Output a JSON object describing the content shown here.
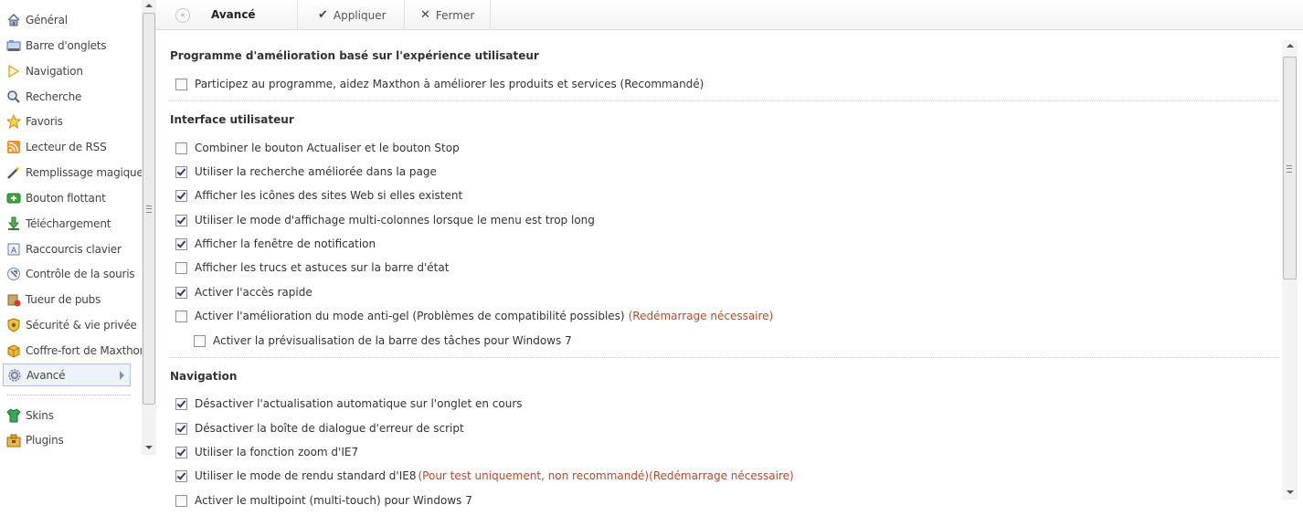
{
  "sidebar": {
    "items": [
      {
        "label": "Général",
        "icon": "home-icon"
      },
      {
        "label": "Barre d'onglets",
        "icon": "tabbar-icon"
      },
      {
        "label": "Navigation",
        "icon": "navigation-arrow-icon"
      },
      {
        "label": "Recherche",
        "icon": "magnifier-icon"
      },
      {
        "label": "Favoris",
        "icon": "star-icon"
      },
      {
        "label": "Lecteur de RSS",
        "icon": "rss-icon"
      },
      {
        "label": "Remplissage magique",
        "icon": "magic-pen-icon"
      },
      {
        "label": "Bouton flottant",
        "icon": "floating-button-icon"
      },
      {
        "label": "Téléchargement",
        "icon": "download-icon"
      },
      {
        "label": "Raccourcis clavier",
        "icon": "keyboard-icon"
      },
      {
        "label": "Contrôle de la souris",
        "icon": "mouse-gesture-icon"
      },
      {
        "label": "Tueur de pubs",
        "icon": "ad-killer-icon"
      },
      {
        "label": "Sécurité & vie privée",
        "icon": "shield-icon"
      },
      {
        "label": "Coffre-fort de Maxthon",
        "icon": "safe-box-icon"
      },
      {
        "label": "Avancé",
        "icon": "gear-icon",
        "active": true
      }
    ],
    "extras": [
      {
        "label": "Skins",
        "icon": "shirt-icon"
      },
      {
        "label": "Plugins",
        "icon": "plugin-box-icon"
      }
    ]
  },
  "toolbar": {
    "back_glyph": "«",
    "title": "Avancé",
    "apply_label": "Appliquer",
    "close_label": "Fermer"
  },
  "sections": [
    {
      "title": "Programme d'amélioration basé sur l'expérience utilisateur",
      "options": [
        {
          "label": "Participez au programme, aidez Maxthon à améliorer les produits et services (Recommandé)",
          "checked": false
        }
      ]
    },
    {
      "title": "Interface utilisateur",
      "options": [
        {
          "label": "Combiner le bouton Actualiser et le bouton Stop",
          "checked": false
        },
        {
          "label": "Utiliser la recherche améliorée dans la page",
          "checked": true
        },
        {
          "label": "Afficher les icônes des sites Web si elles existent",
          "checked": true
        },
        {
          "label": "Utiliser le mode d'affichage multi-colonnes lorsque le menu est trop long",
          "checked": true
        },
        {
          "label": "Afficher la fenêtre de notification",
          "checked": true
        },
        {
          "label": "Afficher les trucs et astuces sur la barre d'état",
          "checked": false
        },
        {
          "label": "Activer l'accès rapide",
          "checked": true
        },
        {
          "label": "Activer l'amélioration du mode anti-gel (Problèmes de compatibilité possibles)",
          "warning": "(Redémarrage nécessaire)",
          "checked": false
        },
        {
          "label": "Activer la prévisualisation de la barre des tâches pour Windows 7",
          "checked": false,
          "indent": true
        }
      ]
    },
    {
      "title": "Navigation",
      "options": [
        {
          "label": "Désactiver l'actualisation automatique sur l'onglet en cours",
          "checked": true
        },
        {
          "label": "Désactiver la boîte de dialogue d'erreur de script",
          "checked": true
        },
        {
          "label": "Utiliser la fonction zoom d'IE7",
          "checked": true
        },
        {
          "label": "Utiliser le mode de rendu standard d'IE8",
          "warning": "(Pour test uniquement, non recommandé)(Redémarrage nécessaire)",
          "checked": true
        },
        {
          "label": "Activer le multipoint (multi-touch) pour Windows 7",
          "checked": false
        }
      ]
    }
  ],
  "colors": {
    "warning": "#b54a2c",
    "active_bg": "#eef3fa",
    "active_border": "#aac4e6"
  }
}
